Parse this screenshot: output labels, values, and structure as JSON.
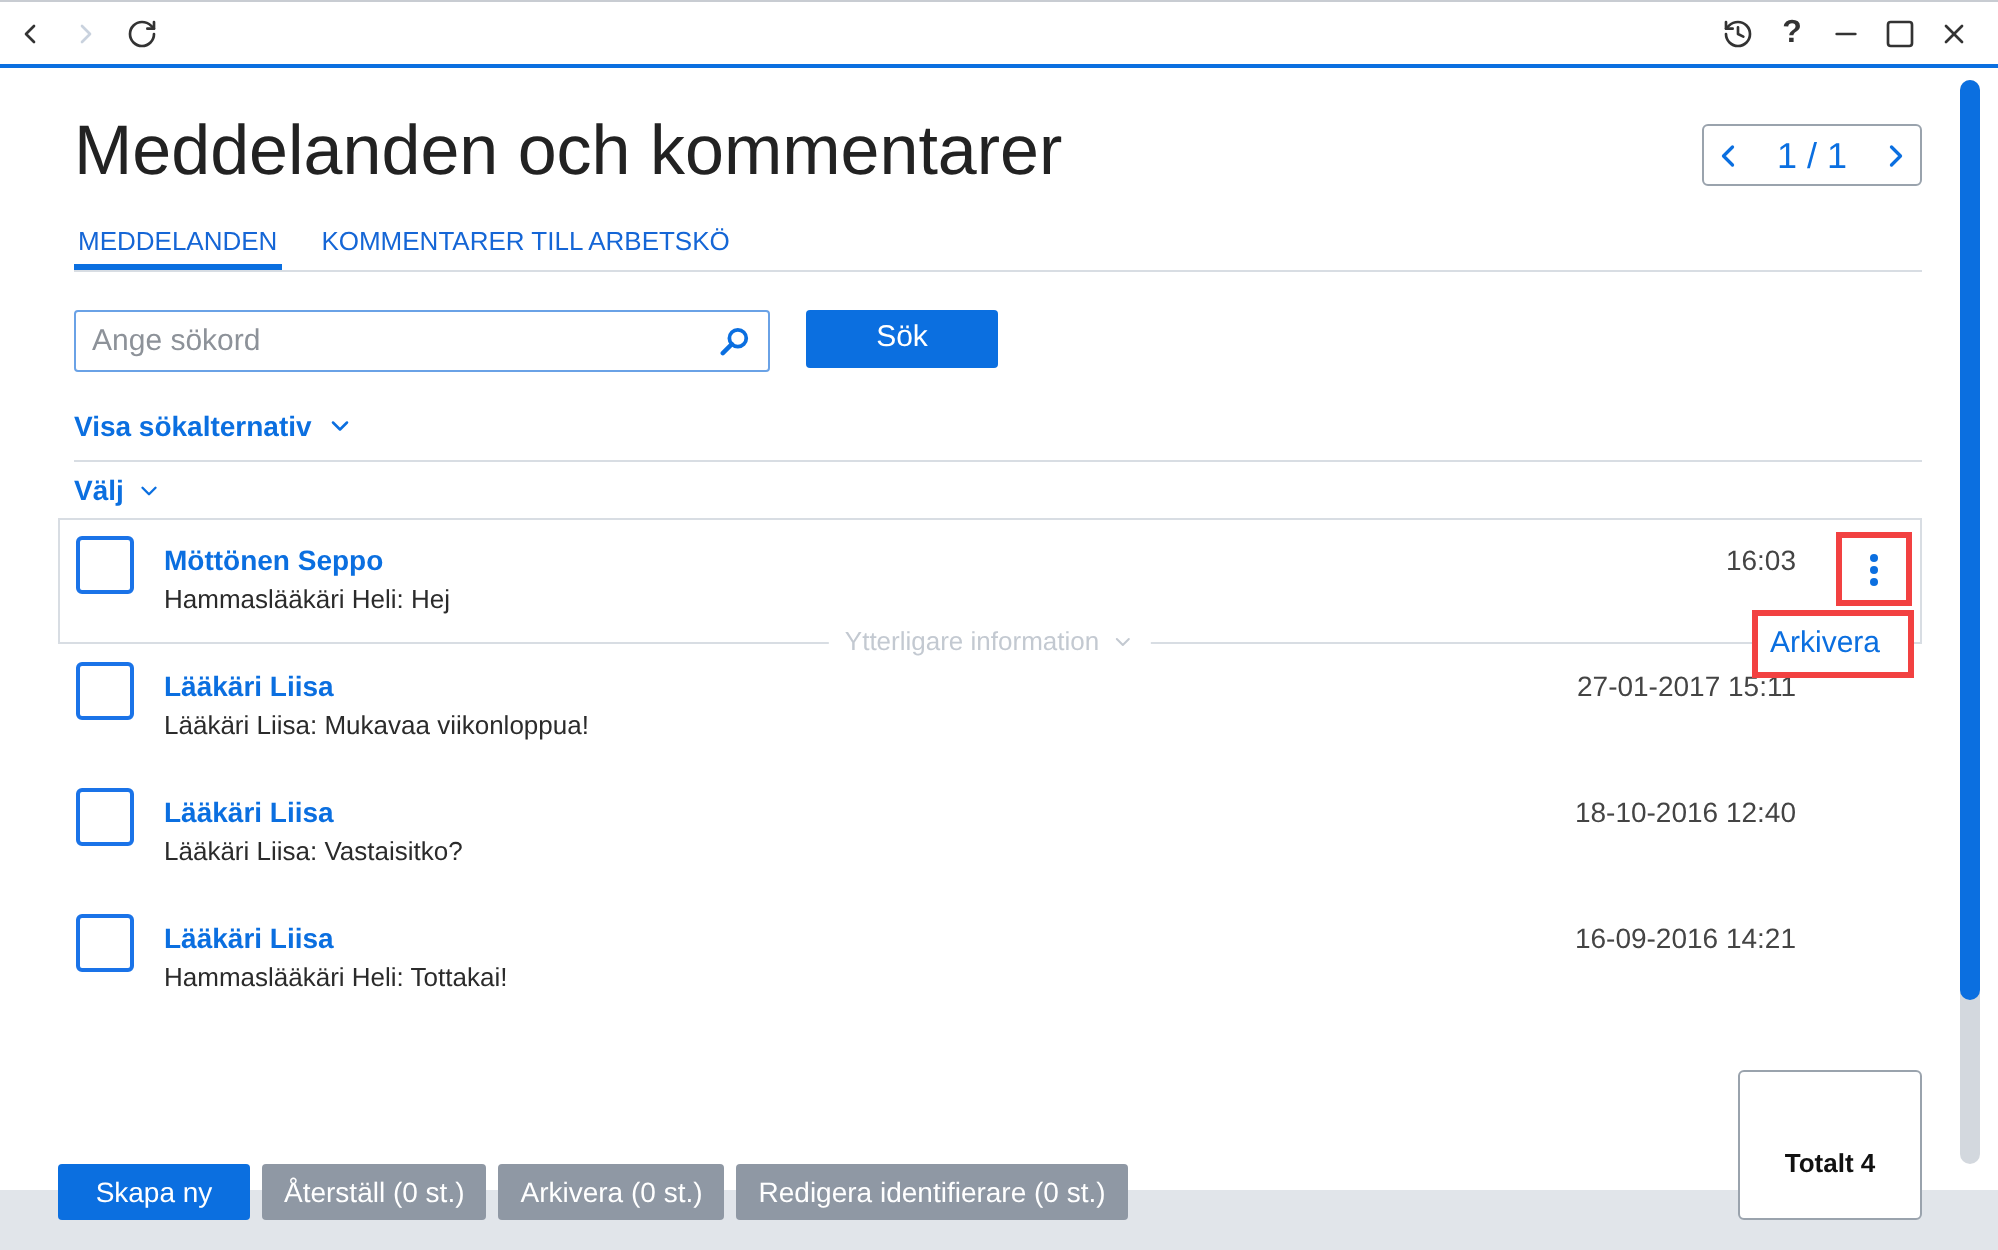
{
  "toolbar": {
    "nav": [
      {
        "kind": "back",
        "disabled": false
      },
      {
        "kind": "forward",
        "disabled": true
      },
      {
        "kind": "reload",
        "disabled": false
      }
    ],
    "controls": [
      {
        "kind": "history"
      },
      {
        "kind": "help",
        "label": "?"
      },
      {
        "kind": "minimize"
      },
      {
        "kind": "maximize"
      },
      {
        "kind": "close"
      }
    ]
  },
  "page": {
    "title": "Meddelanden och kommentarer",
    "pager": {
      "label": "1 / 1"
    }
  },
  "tabs": [
    {
      "label": "MEDDELANDEN",
      "selected": true
    },
    {
      "label": "KOMMENTARER TILL ARBETSKÖ",
      "selected": false
    }
  ],
  "search": {
    "placeholder": "Ange sökord",
    "button": "Sök"
  },
  "search_options": {
    "label": "Visa sökalternativ",
    "expanded": false
  },
  "select_menu": {
    "label": "Välj",
    "expanded": false
  },
  "messages": [
    {
      "sender": "Möttönen Seppo",
      "text": "Hammaslääkäri Heli: Hej",
      "time": "16:03",
      "checked": false,
      "highlighted": true,
      "details_label": "Ytterligare information",
      "menu": {
        "open": true,
        "annotated": true,
        "items": [
          "Arkivera"
        ]
      }
    },
    {
      "sender": "Lääkäri Liisa",
      "text": "Lääkäri Liisa: Mukavaa viikonloppua!",
      "time": "27-01-2017 15:11",
      "checked": false,
      "highlighted": false
    },
    {
      "sender": "Lääkäri Liisa",
      "text": "Lääkäri Liisa: Vastaisitko?",
      "time": "18-10-2016 12:40",
      "checked": false,
      "highlighted": false
    },
    {
      "sender": "Lääkäri Liisa",
      "text": "Hammaslääkäri Heli: Tottakai!",
      "time": "16-09-2016 14:21",
      "checked": false,
      "highlighted": false
    }
  ],
  "actions": [
    {
      "label": "Skapa ny",
      "disabled": false
    },
    {
      "label": "Återställ (0 st.)",
      "disabled": true
    },
    {
      "label": "Arkivera (0 st.)",
      "disabled": true
    },
    {
      "label": "Redigera identifierare (0 st.)",
      "disabled": true
    }
  ],
  "total": "Totalt 4"
}
